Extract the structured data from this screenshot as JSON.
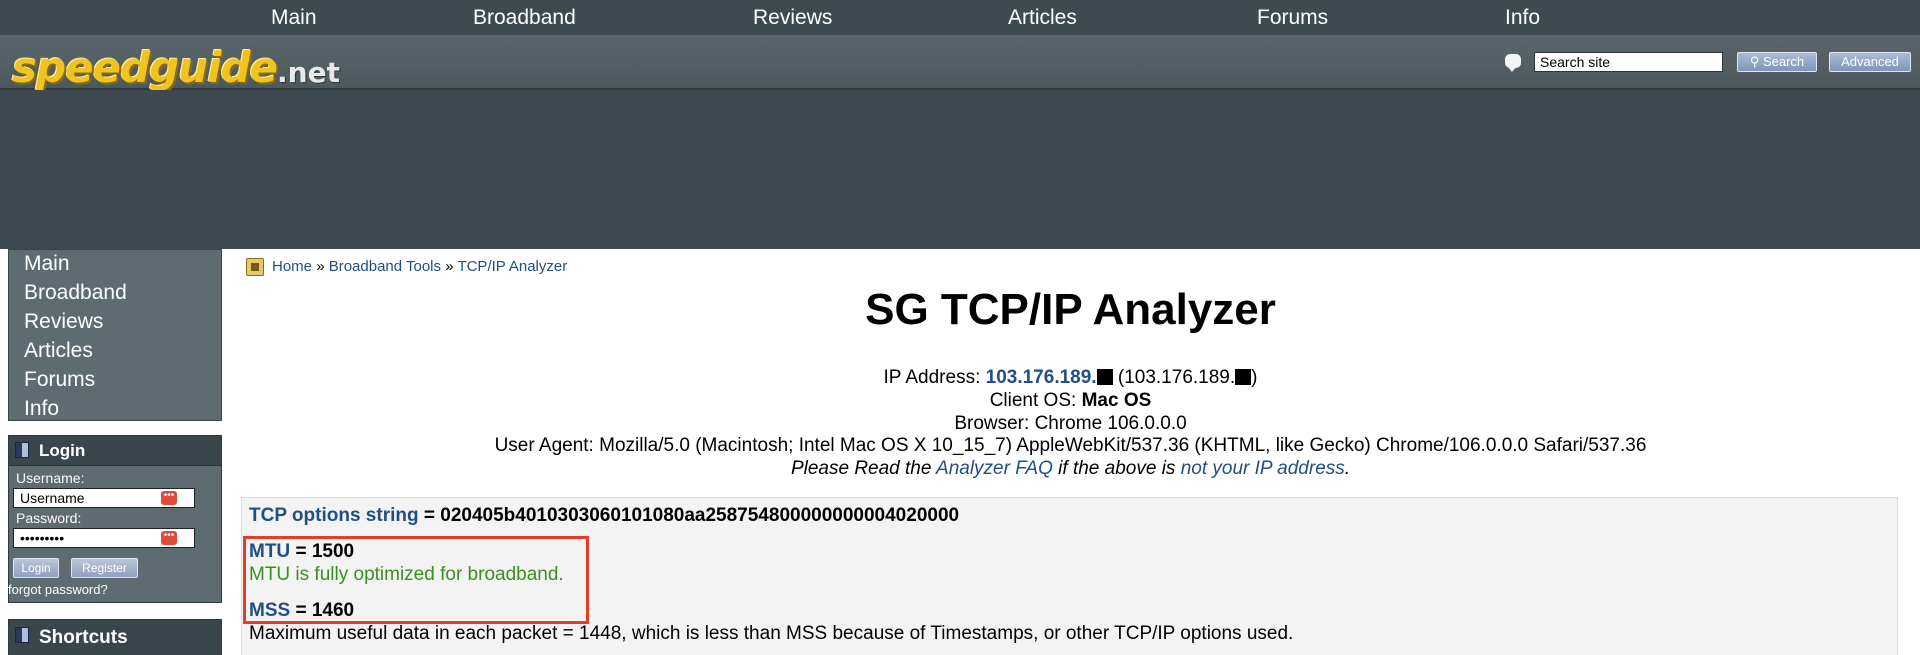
{
  "topnav": {
    "items": [
      "Main",
      "Broadband",
      "Reviews",
      "Articles",
      "Forums",
      "Info"
    ]
  },
  "logo": {
    "text": "speedguide",
    "suffix": ".net"
  },
  "search": {
    "placeholder": "Search site",
    "value": "Search site",
    "search_label": "Search",
    "advanced_label": "Advanced"
  },
  "sidenav": {
    "items": [
      "Main",
      "Broadband",
      "Reviews",
      "Articles",
      "Forums",
      "Info"
    ]
  },
  "login": {
    "title": "Login",
    "username_label": "Username:",
    "username_value": "Username",
    "password_label": "Password:",
    "password_value": "•••••••••",
    "login_button": "Login",
    "register_button": "Register",
    "forgot": "forgot password?"
  },
  "shortcuts": {
    "title": "Shortcuts"
  },
  "breadcrumb": {
    "home": "Home",
    "sep": "»",
    "tools": "Broadband Tools",
    "current": "TCP/IP Analyzer"
  },
  "main": {
    "title": "SG TCP/IP Analyzer",
    "ip_label": "IP Address:",
    "ip_value": "103.176.189.",
    "ip_paren_open": "(103.176.189.",
    "ip_paren_close": ")",
    "os_label": "Client OS:",
    "os_value": "Mac OS",
    "browser_line": "Browser: Chrome 106.0.0.0",
    "ua_line": "User Agent: Mozilla/5.0 (Macintosh; Intel Mac OS X 10_15_7) AppleWebKit/537.36 (KHTML, like Gecko) Chrome/106.0.0.0 Safari/537.36",
    "faq_pre": "Please Read the",
    "faq_link": "Analyzer FAQ",
    "faq_mid": "if the above is",
    "faq_link2": "not your IP address",
    "faq_end": "."
  },
  "results": {
    "tcp_label": "TCP options string",
    "eq": "=",
    "tcp_value": "020405b4010303060101080aa258754800000000004020000",
    "mtu_label": "MTU",
    "mtu_value": "1500",
    "mtu_note": "MTU is fully optimized for broadband.",
    "mss_label": "MSS",
    "mss_value": "1460",
    "mss_note": "Maximum useful data in each packet = 1448, which is less than MSS because of Timestamps, or other TCP/IP options used."
  }
}
